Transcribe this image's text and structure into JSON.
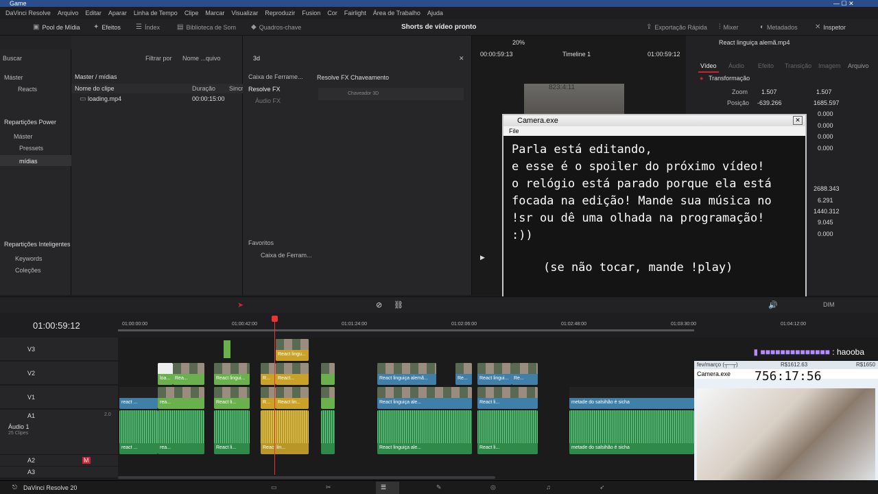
{
  "app": {
    "title": "Game",
    "menu": [
      "DaVinci Resolve",
      "Arquivo",
      "Editar",
      "Aparar",
      "Linha de Tempo",
      "Clipe",
      "Marcar",
      "Visualizar",
      "Reproduzir",
      "Fusion",
      "Cor",
      "Fairlight",
      "Área de Trabalho",
      "Ajuda"
    ]
  },
  "toolbar": {
    "media_pool": "Pool de Mídia",
    "effects": "Efeitos",
    "index": "Índex",
    "sound_library": "Biblioteca de Som",
    "keyframes": "Quadros-chave",
    "project_title": "Shorts de vídeo pronto",
    "quick_export": "Exportação Rápida",
    "mixer": "Mixer",
    "metadata": "Metadados",
    "inspector": "Inspetor"
  },
  "media": {
    "search_placeholder": "Buscar",
    "filter_label": "Filtrar por",
    "filter_value": "Nome ...quivo",
    "breadcrumb": "Master / mídias",
    "col_name": "Nome do clipe",
    "col_duration": "Duração",
    "col_sync": "Sincr",
    "clip_name": "loading.mp4",
    "clip_duration": "00:00:15:00"
  },
  "bins": {
    "master": "Máster",
    "reacts": "Reacts",
    "power_bins": "Repartições Power",
    "power_master": "Máster",
    "pressets": "Pressets",
    "midias": "mídias",
    "smart_bins": "Repartições Inteligentes",
    "keywords": "Keywords",
    "collections": "Coleções"
  },
  "effects": {
    "search": "3d",
    "toolbox": "Caixa de Ferrame...",
    "resolve_fx": "Resolve FX",
    "audio_fx": "Áudio FX",
    "favorites": "Favoritos",
    "fav_toolbox": "Caixa de Ferram...",
    "category": "Resolve FX Chaveamento",
    "item": "Chaveador 3D"
  },
  "viewer": {
    "zoom": "20%",
    "timecode_left": "00:00:59:13",
    "timeline_name": "Timeline 1",
    "timecode_right": "01:00:59:12"
  },
  "inspector": {
    "clip_title": "React linguiça alemã.mp4",
    "tabs": [
      "Vídeo",
      "Áudio",
      "Efeito",
      "Transição",
      "Imagem",
      "Arquivo"
    ],
    "section": "Transformação",
    "zoom_label": "Zoom",
    "zoom_x": "1.507",
    "zoom_y": "1.507",
    "pos_label": "Posição",
    "pos_x": "-639.266",
    "pos_y": "1685.597",
    "values": [
      "0.000",
      "0.000",
      "0.000",
      "0.000",
      "2688.343",
      "6.291",
      "1440.312",
      "9.045",
      "0.000"
    ]
  },
  "popup": {
    "title": "Camera.exe",
    "menu": "File",
    "lines": [
      "Parla está editando,",
      "e esse é o spoiler do próximo vídeo!",
      "o relógio está parado porque ela está",
      "focada na edição! Mande sua música no",
      "!sr ou dê uma olhada na programação!",
      ":))"
    ],
    "footer": "(se não tocar, mande !play)",
    "overlay_counter": "823:4:11"
  },
  "timeline": {
    "timecode": "01:00:59:12",
    "ruler": [
      "01:00:00:00",
      "01:00:42:00",
      "01:01:24:00",
      "01:02:06:00",
      "01:02:48:00",
      "01:03:30:00",
      "01:04:12:00"
    ],
    "tracks": [
      "V3",
      "V2",
      "V1",
      "A1",
      "A2",
      "A3"
    ],
    "audio_track_name": "Áudio 1",
    "audio_clip_count": "25 Clipes",
    "audio_level": "2.0",
    "dim_label": "DIM"
  },
  "clips": {
    "v2": [
      "loa...",
      "Rea...",
      "React lingui...",
      "R...",
      "React...",
      "React linguiça alemã...",
      "Re...",
      "React lingui...",
      "Re..."
    ],
    "v1": [
      "react ...",
      "rea...",
      "React li...",
      "R...",
      "React lin...",
      "React linguiça ale...",
      "React li...",
      "metade do salsihão é sicha"
    ],
    "a1": [
      "react ...",
      "rea...",
      "React li...",
      "React lin...",
      "React linguiça ale...",
      "React li...",
      "metade do salsihão é sicha"
    ],
    "v3": [
      "React lingu..."
    ]
  },
  "stream": {
    "chat_user": "haooba",
    "date": "fev/março (┬─┬)",
    "r1": "R$1612.63",
    "r2": "R$1650",
    "cam_title": "Camera.exe",
    "clock": "756:17:56"
  },
  "footer": {
    "app_name": "DaVinci Resolve 20"
  }
}
